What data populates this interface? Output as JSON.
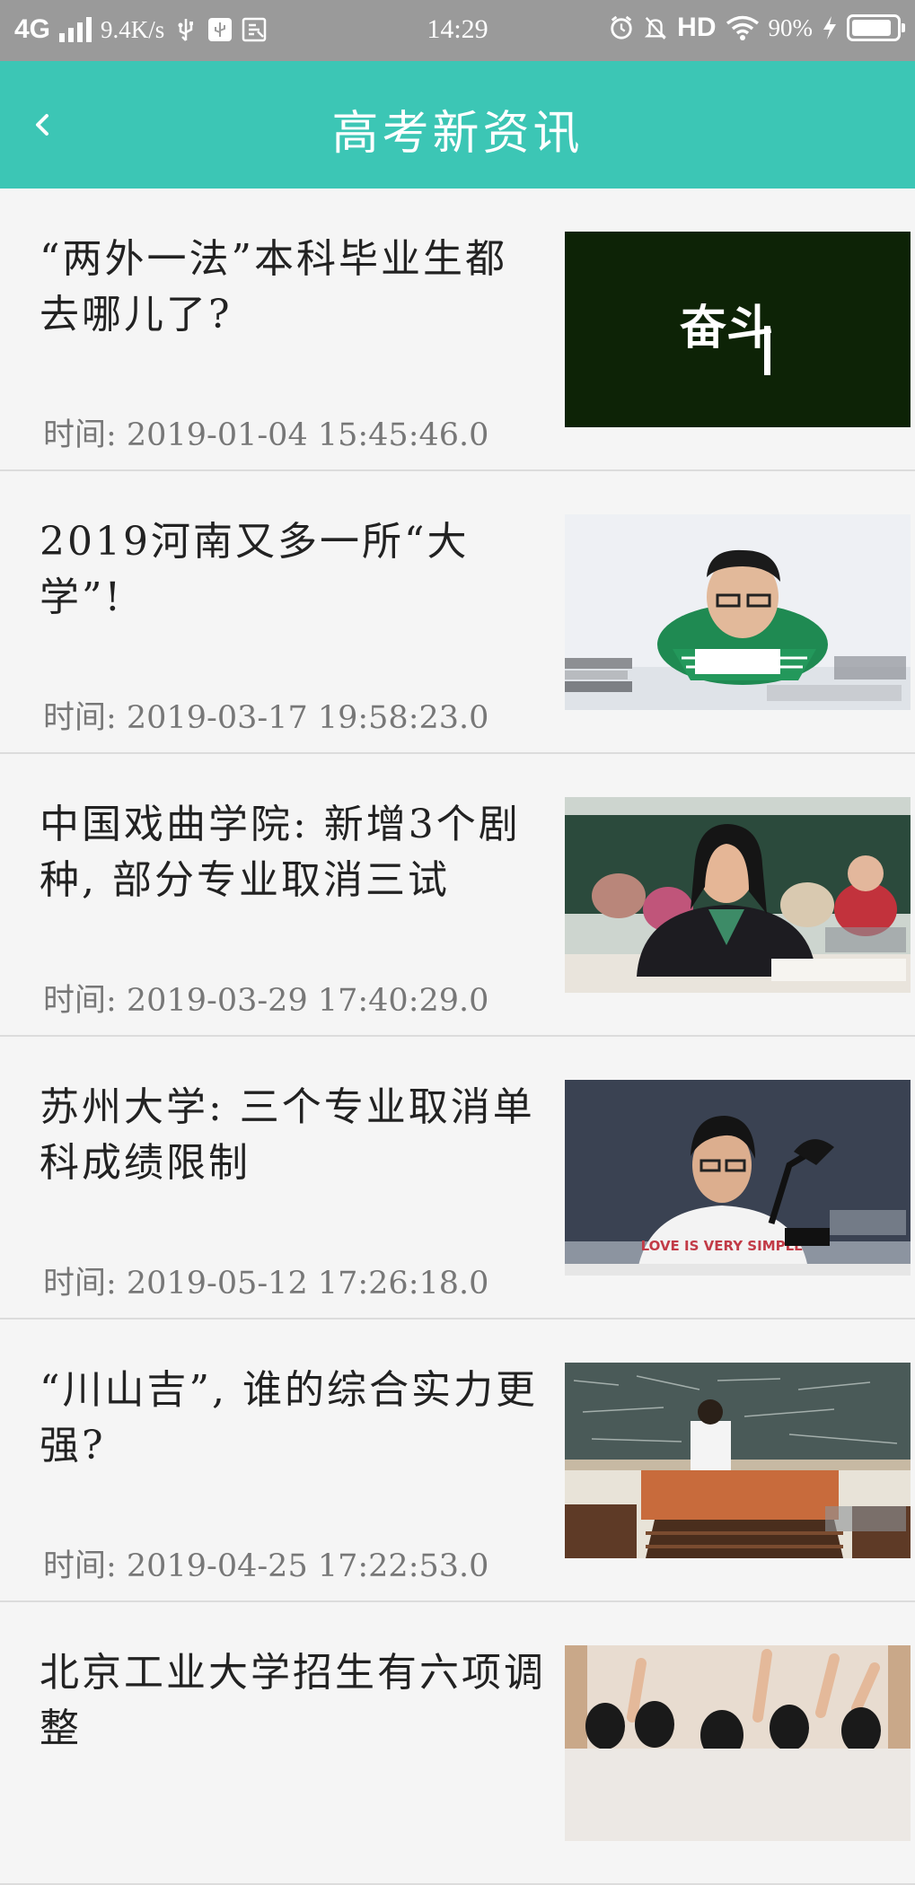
{
  "status_bar": {
    "network": "4G",
    "speed": "9.4K/s",
    "time": "14:29",
    "hd": "HD",
    "battery": "90%",
    "battery_level": 0.9,
    "icons": [
      "signal-icon",
      "usb-icon",
      "usb-debug-icon",
      "screenshot-icon",
      "alarm-icon",
      "mute-icon",
      "wifi-icon",
      "charging-icon",
      "battery-icon"
    ]
  },
  "header": {
    "title": "高考新资讯",
    "back_icon": "chevron-left-icon",
    "bg_color": "#3cc6b5"
  },
  "news": [
    {
      "title": "“两外一法”本科毕业生都去哪儿了?",
      "time": "时间: 2019-01-04 15:45:46.0",
      "image_text": "奋斗"
    },
    {
      "title": "2019河南又多一所“大学”!",
      "time": "时间: 2019-03-17 19:58:23.0"
    },
    {
      "title": "中国戏曲学院: 新增3个剧种, 部分专业取消三试",
      "time": "时间: 2019-03-29 17:40:29.0"
    },
    {
      "title": "苏州大学: 三个专业取消单科成绩限制",
      "time": "时间: 2019-05-12 17:26:18.0",
      "image_text": "LOVE IS VERY SIMPLE"
    },
    {
      "title": "“川山吉”, 谁的综合实力更强?",
      "time": "时间: 2019-04-25 17:22:53.0"
    },
    {
      "title": "北京工业大学招生有六项调整"
    }
  ]
}
